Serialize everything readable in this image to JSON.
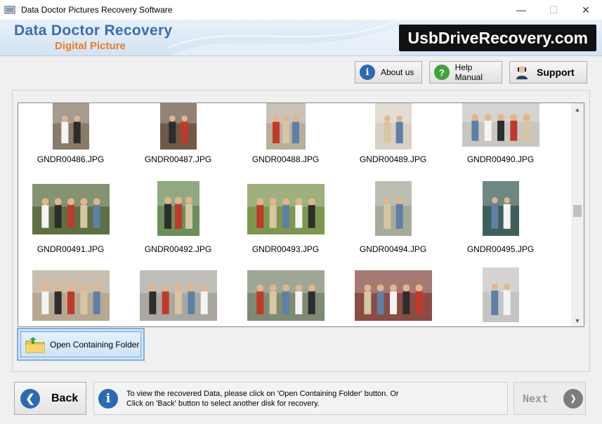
{
  "window": {
    "title": "Data Doctor Pictures Recovery Software",
    "controls": {
      "minimize": "—",
      "maximize": "☐",
      "close": "✕"
    }
  },
  "banner": {
    "brand_line1": "Data Doctor Recovery",
    "brand_line2": "Digital Picture",
    "site": "UsbDriveRecovery.com"
  },
  "toolbar": {
    "about_label": "About us",
    "help_label": "Help Manual",
    "support_label": "Support"
  },
  "files": [
    {
      "name": "GNDR00486.JPG",
      "color": "#8a7a6a"
    },
    {
      "name": "GNDR00487.JPG",
      "color": "#6f5a48"
    },
    {
      "name": "GNDR00488.JPG",
      "color": "#b8ae9e"
    },
    {
      "name": "GNDR00489.JPG",
      "color": "#d8d0c4"
    },
    {
      "name": "GNDR00490.JPG",
      "color": "#c9c6c0"
    },
    {
      "name": "GNDR00491.JPG",
      "color": "#5e6f44"
    },
    {
      "name": "GNDR00492.JPG",
      "color": "#6d8d5a"
    },
    {
      "name": "GNDR00493.JPG",
      "color": "#7f9650"
    },
    {
      "name": "GNDR00494.JPG",
      "color": "#a7a99a"
    },
    {
      "name": "GNDR00495.JPG",
      "color": "#3f5f5a"
    },
    {
      "name": "",
      "color": "#b7a892"
    },
    {
      "name": "",
      "color": "#a9a7a0"
    },
    {
      "name": "",
      "color": "#7e8a72"
    },
    {
      "name": "",
      "color": "#8a4c44"
    },
    {
      "name": "",
      "color": "#c7c5c3"
    }
  ],
  "open_folder_label": "Open Containing Folder",
  "footer": {
    "back_label": "Back",
    "info_line1": "To view the recovered Data, please click on 'Open Containing Folder' button. Or",
    "info_line2": "Click on 'Back' button to select another disk for recovery.",
    "next_label": "Next"
  },
  "colors": {
    "accent_blue": "#2a6ab2",
    "help_green": "#3ea43a",
    "brand_orange": "#f07a20"
  }
}
